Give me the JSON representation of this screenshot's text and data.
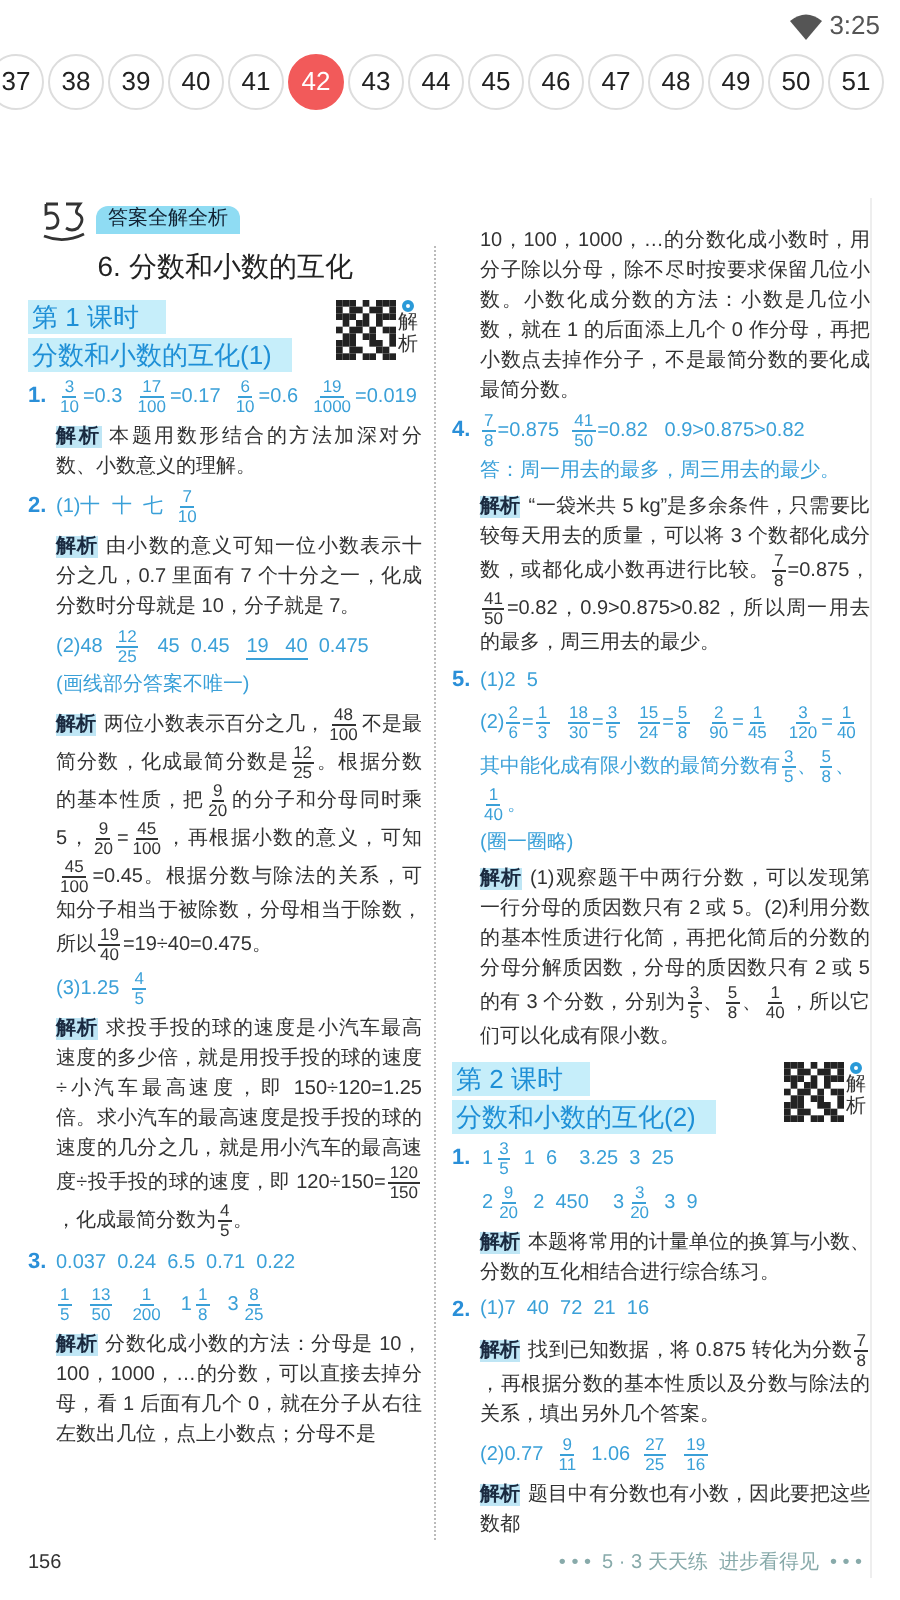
{
  "status_bar": {
    "time": "3:25"
  },
  "pages": [
    {
      "label": "37",
      "selected": false
    },
    {
      "label": "38",
      "selected": false
    },
    {
      "label": "39",
      "selected": false
    },
    {
      "label": "40",
      "selected": false
    },
    {
      "label": "41",
      "selected": false
    },
    {
      "label": "42",
      "selected": true
    },
    {
      "label": "43",
      "selected": false
    },
    {
      "label": "44",
      "selected": false
    },
    {
      "label": "45",
      "selected": false
    },
    {
      "label": "46",
      "selected": false
    },
    {
      "label": "47",
      "selected": false
    },
    {
      "label": "48",
      "selected": false
    },
    {
      "label": "49",
      "selected": false
    },
    {
      "label": "50",
      "selected": false
    },
    {
      "label": "51",
      "selected": false
    }
  ],
  "document": {
    "badge": "答案全解全析",
    "columns": [
      [
        {
          "kind": "heading",
          "text": "6. 分数和小数的互化"
        },
        {
          "kind": "lesson",
          "label": "第 1 课时",
          "title": "分数和小数的互化(1)",
          "qr_caption": "解析"
        },
        {
          "kind": "answer",
          "number": "1.",
          "parts": [
            {
              "kind": "fraction",
              "num": "3",
              "den": "10"
            },
            {
              "kind": "text",
              "text": "=0.3  "
            },
            {
              "kind": "fraction",
              "num": "17",
              "den": "100"
            },
            {
              "kind": "text",
              "text": "=0.17  "
            },
            {
              "kind": "fraction",
              "num": "6",
              "den": "10"
            },
            {
              "kind": "text",
              "text": "=0.6  "
            },
            {
              "kind": "fraction",
              "num": "19",
              "den": "1000"
            },
            {
              "kind": "text",
              "text": "=0.019"
            }
          ]
        },
        {
          "kind": "analysis",
          "label": "解析",
          "parts": [
            {
              "kind": "text",
              "text": "本题用数形结合的方法加深对分数、小数意义的理解。"
            }
          ]
        },
        {
          "kind": "answer",
          "number": "2.",
          "parts": [
            {
              "kind": "text",
              "text": "(1)十  十  七  "
            },
            {
              "kind": "fraction",
              "num": "7",
              "den": "10"
            }
          ]
        },
        {
          "kind": "analysis",
          "label": "解析",
          "parts": [
            {
              "kind": "text",
              "text": "由小数的意义可知一位小数表示十分之几，0.7 里面有 7 个十分之一，化成分数时分母就是 10，分子就是 7。"
            }
          ]
        },
        {
          "kind": "answer",
          "parts": [
            {
              "kind": "text",
              "text": "(2)48  "
            },
            {
              "kind": "fraction",
              "num": "12",
              "den": "25"
            },
            {
              "kind": "text",
              "text": "   45  0.45   "
            },
            {
              "kind": "underline",
              "text": "19   40"
            },
            {
              "kind": "text",
              "text": "  0.475"
            }
          ]
        },
        {
          "kind": "note",
          "text": "(画线部分答案不唯一)"
        },
        {
          "kind": "analysis",
          "label": "解析",
          "parts": [
            {
              "kind": "text",
              "text": "两位小数表示百分之几，"
            },
            {
              "kind": "fraction",
              "num": "48",
              "den": "100"
            },
            {
              "kind": "text",
              "text": "不是最简分数，化成最简分数是"
            },
            {
              "kind": "fraction",
              "num": "12",
              "den": "25"
            },
            {
              "kind": "text",
              "text": "。根据分数的基本性质，把"
            },
            {
              "kind": "fraction",
              "num": "9",
              "den": "20"
            },
            {
              "kind": "text",
              "text": "的分子和分母同时乘 5，"
            },
            {
              "kind": "fraction",
              "num": "9",
              "den": "20"
            },
            {
              "kind": "text",
              "text": "="
            },
            {
              "kind": "fraction",
              "num": "45",
              "den": "100"
            },
            {
              "kind": "text",
              "text": "，再根据小数的意义，可知"
            },
            {
              "kind": "fraction",
              "num": "45",
              "den": "100"
            },
            {
              "kind": "text",
              "text": "=0.45。根据分数与除法的关系，可知分子相当于被除数，分母相当于除数，所以"
            },
            {
              "kind": "fraction",
              "num": "19",
              "den": "40"
            },
            {
              "kind": "text",
              "text": "=19÷40=0.475。"
            }
          ]
        },
        {
          "kind": "answer",
          "parts": [
            {
              "kind": "text",
              "text": "(3)1.25  "
            },
            {
              "kind": "fraction",
              "num": "4",
              "den": "5"
            }
          ]
        },
        {
          "kind": "analysis",
          "label": "解析",
          "parts": [
            {
              "kind": "text",
              "text": "求投手投的球的速度是小汽车最高速度的多少倍，就是用投手投的球的速度÷小汽车最高速度，即 150÷120=1.25 倍。求小汽车的最高速度是投手投的球的速度的几分之几，就是用小汽车的最高速度÷投手投的球的速度，即 120÷150="
            },
            {
              "kind": "fraction",
              "num": "120",
              "den": "150"
            },
            {
              "kind": "text",
              "text": "，化成最简分数为"
            },
            {
              "kind": "fraction",
              "num": "4",
              "den": "5"
            },
            {
              "kind": "text",
              "text": "。"
            }
          ]
        },
        {
          "kind": "answer",
          "number": "3.",
          "parts": [
            {
              "kind": "text",
              "text": "0.037  0.24  6.5  0.71  0.22"
            }
          ]
        },
        {
          "kind": "answer",
          "parts": [
            {
              "kind": "fraction",
              "num": "1",
              "den": "5"
            },
            {
              "kind": "fraction",
              "num": "13",
              "den": "50"
            },
            {
              "kind": "fraction",
              "num": "1",
              "den": "200"
            },
            {
              "kind": "fraction",
              "whole": "1",
              "num": "1",
              "den": "8"
            },
            {
              "kind": "fraction",
              "whole": "3",
              "num": "8",
              "den": "25"
            }
          ]
        },
        {
          "kind": "analysis",
          "label": "解析",
          "parts": [
            {
              "kind": "text",
              "text": "分数化成小数的方法：分母是 10，100，1000，…的分数，可以直接去掉分母，看 1 后面有几个 0，就在分子从右往左数出几位，点上小数点；分母不是"
            }
          ]
        }
      ],
      [
        {
          "kind": "text",
          "parts": [
            {
              "kind": "text",
              "text": "10，100，1000，…的分数化成小数时，用分子除以分母，除不尽时按要求保留几位小数。小数化成分数的方法：小数是几位小数，就在 1 的后面添上几个 0 作分母，再把小数点去掉作分子，不是最简分数的要化成最简分数。"
            }
          ]
        },
        {
          "kind": "answer",
          "number": "4.",
          "parts": [
            {
              "kind": "fraction",
              "num": "7",
              "den": "8"
            },
            {
              "kind": "text",
              "text": "=0.875  "
            },
            {
              "kind": "fraction",
              "num": "41",
              "den": "50"
            },
            {
              "kind": "text",
              "text": "=0.82   0.9>0.875>0.82"
            }
          ]
        },
        {
          "kind": "answer",
          "parts": [
            {
              "kind": "text",
              "text": "答：周一用去的最多，周三用去的最少。"
            }
          ]
        },
        {
          "kind": "analysis",
          "label": "解析",
          "parts": [
            {
              "kind": "text",
              "text": "“一袋米共 5 kg”是多余条件，只需要比较每天用去的质量，可以将 3 个数都化成分数，或都化成小数再进行比较。"
            },
            {
              "kind": "fraction",
              "num": "7",
              "den": "8"
            },
            {
              "kind": "text",
              "text": "=0.875，"
            },
            {
              "kind": "fraction",
              "num": "41",
              "den": "50"
            },
            {
              "kind": "text",
              "text": "=0.82，0.9>0.875>0.82，所以周一用去的最多，周三用去的最少。"
            }
          ]
        },
        {
          "kind": "answer",
          "number": "5.",
          "parts": [
            {
              "kind": "text",
              "text": "(1)2  5"
            }
          ]
        },
        {
          "kind": "answer",
          "parts": [
            {
              "kind": "text",
              "text": "(2)"
            },
            {
              "kind": "fraction",
              "num": "2",
              "den": "6"
            },
            {
              "kind": "text",
              "text": "="
            },
            {
              "kind": "fraction",
              "num": "1",
              "den": "3"
            },
            {
              "kind": "fraction",
              "num": "18",
              "den": "30"
            },
            {
              "kind": "text",
              "text": "="
            },
            {
              "kind": "fraction",
              "num": "3",
              "den": "5"
            },
            {
              "kind": "fraction",
              "num": "15",
              "den": "24"
            },
            {
              "kind": "text",
              "text": "="
            },
            {
              "kind": "fraction",
              "num": "5",
              "den": "8"
            },
            {
              "kind": "fraction",
              "num": "2",
              "den": "90"
            },
            {
              "kind": "text",
              "text": "="
            },
            {
              "kind": "fraction",
              "num": "1",
              "den": "45"
            },
            {
              "kind": "fraction",
              "num": "3",
              "den": "120"
            },
            {
              "kind": "text",
              "text": "="
            },
            {
              "kind": "fraction",
              "num": "1",
              "den": "40"
            }
          ]
        },
        {
          "kind": "answer",
          "parts": [
            {
              "kind": "text",
              "text": "其中能化成有限小数的最简分数有"
            },
            {
              "kind": "fraction",
              "num": "3",
              "den": "5"
            },
            {
              "kind": "text",
              "text": "、"
            },
            {
              "kind": "fraction",
              "num": "5",
              "den": "8"
            },
            {
              "kind": "text",
              "text": "、"
            },
            {
              "kind": "fraction",
              "num": "1",
              "den": "40"
            },
            {
              "kind": "text",
              "text": "。"
            }
          ]
        },
        {
          "kind": "note",
          "text": "(圈一圈略)"
        },
        {
          "kind": "analysis",
          "label": "解析",
          "parts": [
            {
              "kind": "text",
              "text": "(1)观察题干中两行分数，可以发现第一行分母的质因数只有 2 或 5。(2)利用分数的基本性质进行化简，再把化简后的分数的分母分解质因数，分母的质因数只有 2 或 5 的有 3 个分数，分别为"
            },
            {
              "kind": "fraction",
              "num": "3",
              "den": "5"
            },
            {
              "kind": "text",
              "text": "、"
            },
            {
              "kind": "fraction",
              "num": "5",
              "den": "8"
            },
            {
              "kind": "text",
              "text": "、"
            },
            {
              "kind": "fraction",
              "num": "1",
              "den": "40"
            },
            {
              "kind": "text",
              "text": "，所以它们可以化成有限小数。"
            }
          ]
        },
        {
          "kind": "lesson",
          "label": "第 2 课时",
          "title": "分数和小数的互化(2)",
          "qr_caption": "解析"
        },
        {
          "kind": "answer",
          "number": "1.",
          "parts": [
            {
              "kind": "fraction",
              "whole": "1",
              "num": "3",
              "den": "5"
            },
            {
              "kind": "text",
              "text": "  1  6    3.25  3  25"
            }
          ]
        },
        {
          "kind": "answer",
          "parts": [
            {
              "kind": "fraction",
              "whole": "2",
              "num": "9",
              "den": "20"
            },
            {
              "kind": "text",
              "text": "  2  450    "
            },
            {
              "kind": "fraction",
              "whole": "3",
              "num": "3",
              "den": "20"
            },
            {
              "kind": "text",
              "text": "  3  9"
            }
          ]
        },
        {
          "kind": "analysis",
          "label": "解析",
          "parts": [
            {
              "kind": "text",
              "text": "本题将常用的计量单位的换算与小数、分数的互化相结合进行综合练习。"
            }
          ]
        },
        {
          "kind": "answer",
          "number": "2.",
          "parts": [
            {
              "kind": "text",
              "text": "(1)7  40  72  21  16"
            }
          ]
        },
        {
          "kind": "analysis",
          "label": "解析",
          "parts": [
            {
              "kind": "text",
              "text": "找到已知数据，将 0.875 转化为分数"
            },
            {
              "kind": "fraction",
              "num": "7",
              "den": "8"
            },
            {
              "kind": "text",
              "text": "，再根据分数的基本性质以及分数与除法的关系，填出另外几个答案。"
            }
          ]
        },
        {
          "kind": "answer",
          "parts": [
            {
              "kind": "text",
              "text": "(2)0.77  "
            },
            {
              "kind": "fraction",
              "num": "9",
              "den": "11"
            },
            {
              "kind": "text",
              "text": "  1.06  "
            },
            {
              "kind": "fraction",
              "num": "27",
              "den": "25"
            },
            {
              "kind": "fraction",
              "num": "19",
              "den": "16"
            }
          ]
        },
        {
          "kind": "analysis",
          "label": "解析",
          "parts": [
            {
              "kind": "text",
              "text": "题目中有分数也有小数，因此要把这些数都"
            }
          ]
        }
      ]
    ],
    "footer": {
      "page_number": "156",
      "slogan": "• • •  5 · 3 天天练  进步看得见  • • •"
    }
  }
}
